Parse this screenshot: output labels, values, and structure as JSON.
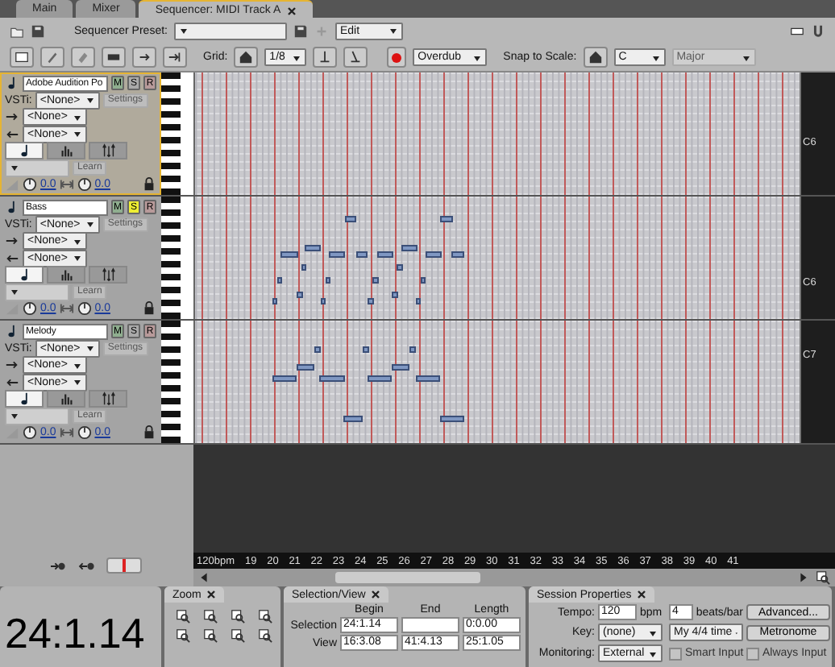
{
  "tabs": [
    {
      "label": "Main",
      "selected": false,
      "closable": false
    },
    {
      "label": "Mixer",
      "selected": false,
      "closable": false
    },
    {
      "label": "Sequencer: MIDI Track A",
      "selected": true,
      "closable": true
    }
  ],
  "toolbar": {
    "preset_label": "Sequencer Preset:",
    "mode": "Edit",
    "grid_label": "Grid:",
    "grid_value": "1/8",
    "record_mode": "Overdub",
    "snap_label": "Snap to Scale:",
    "scale_key": "C",
    "scale_type": {
      "label": "Major",
      "disabled": true
    }
  },
  "tracks": [
    {
      "name": "Adobe Audition Po",
      "selected": true,
      "buttons": [
        {
          "kind": "mute",
          "label": "M",
          "on": false
        },
        {
          "kind": "solo",
          "label": "S",
          "on": false
        },
        {
          "kind": "record",
          "label": "R",
          "on": false
        }
      ],
      "vsti_label": "VSTi:",
      "vsti": "<None>",
      "input": "<None>",
      "output": "<None>",
      "settings": {
        "label": "Settings",
        "disabled": true
      },
      "views": [
        {
          "kind": "notes",
          "selected": true
        },
        {
          "kind": "levels",
          "selected": false
        },
        {
          "kind": "transpose",
          "selected": false
        }
      ],
      "learn": {
        "label": "Learn",
        "disabled": true
      },
      "volume": "0.0",
      "pan": "0.0",
      "key_label": "C6"
    },
    {
      "name": "Bass",
      "selected": false,
      "buttons": [
        {
          "kind": "mute",
          "label": "M",
          "on": false
        },
        {
          "kind": "solo",
          "label": "S",
          "on": true
        },
        {
          "kind": "record",
          "label": "R",
          "on": false
        }
      ],
      "vsti_label": "VSTi:",
      "vsti": "<None>",
      "input": "<None>",
      "output": "<None>",
      "settings": {
        "label": "Settings",
        "disabled": true
      },
      "views": [
        {
          "kind": "notes",
          "selected": true
        },
        {
          "kind": "levels",
          "selected": false
        },
        {
          "kind": "transpose",
          "selected": false
        }
      ],
      "learn": {
        "label": "Learn",
        "disabled": true
      },
      "volume": "0.0",
      "pan": "0.0",
      "key_label": "C6"
    },
    {
      "name": "Melody",
      "selected": false,
      "buttons": [
        {
          "kind": "mute",
          "label": "M",
          "on": false
        },
        {
          "kind": "solo",
          "label": "S",
          "on": false
        },
        {
          "kind": "record",
          "label": "R",
          "on": false
        }
      ],
      "vsti_label": "VSTi:",
      "vsti": "<None>",
      "input": "<None>",
      "output": "<None>",
      "settings": {
        "label": "Settings",
        "disabled": true
      },
      "views": [
        {
          "kind": "notes",
          "selected": true
        },
        {
          "kind": "levels",
          "selected": false
        },
        {
          "kind": "transpose",
          "selected": false
        }
      ],
      "learn": {
        "label": "Learn",
        "disabled": true
      },
      "volume": "0.0",
      "pan": "0.0",
      "key_label": "C7"
    }
  ],
  "ruler": {
    "tempo": "120bpm",
    "bars": [
      "19",
      "20",
      "21",
      "22",
      "23",
      "24",
      "25",
      "26",
      "27",
      "28",
      "29",
      "30",
      "31",
      "32",
      "33",
      "34",
      "35",
      "36",
      "37",
      "38",
      "39",
      "40",
      "41"
    ]
  },
  "time_display": "24:1.14",
  "zoom_panel": {
    "title": "Zoom"
  },
  "selection_view": {
    "title": "Selection/View",
    "columns": [
      "Begin",
      "End",
      "Length"
    ],
    "rows": [
      {
        "label": "Selection",
        "begin": "24:1.14",
        "length": "0:0.00"
      },
      {
        "label": "View",
        "begin": "16:3.08",
        "end": "41:4.13",
        "length": "25:1.05"
      }
    ]
  },
  "session": {
    "title": "Session Properties",
    "tempo_label": "Tempo:",
    "tempo": "120",
    "tempo_unit": "bpm",
    "beats": "4",
    "beats_unit": "beats/bar",
    "advanced": "Advanced...",
    "key_label": "Key:",
    "key": "(none)",
    "time_signature": "My 4/4 time",
    "metronome": "Metronome",
    "monitoring_label": "Monitoring:",
    "monitoring": "External",
    "smart_input": {
      "label": "Smart Input",
      "checked": false
    },
    "always_input": {
      "label": "Always Input",
      "checked": false
    }
  }
}
